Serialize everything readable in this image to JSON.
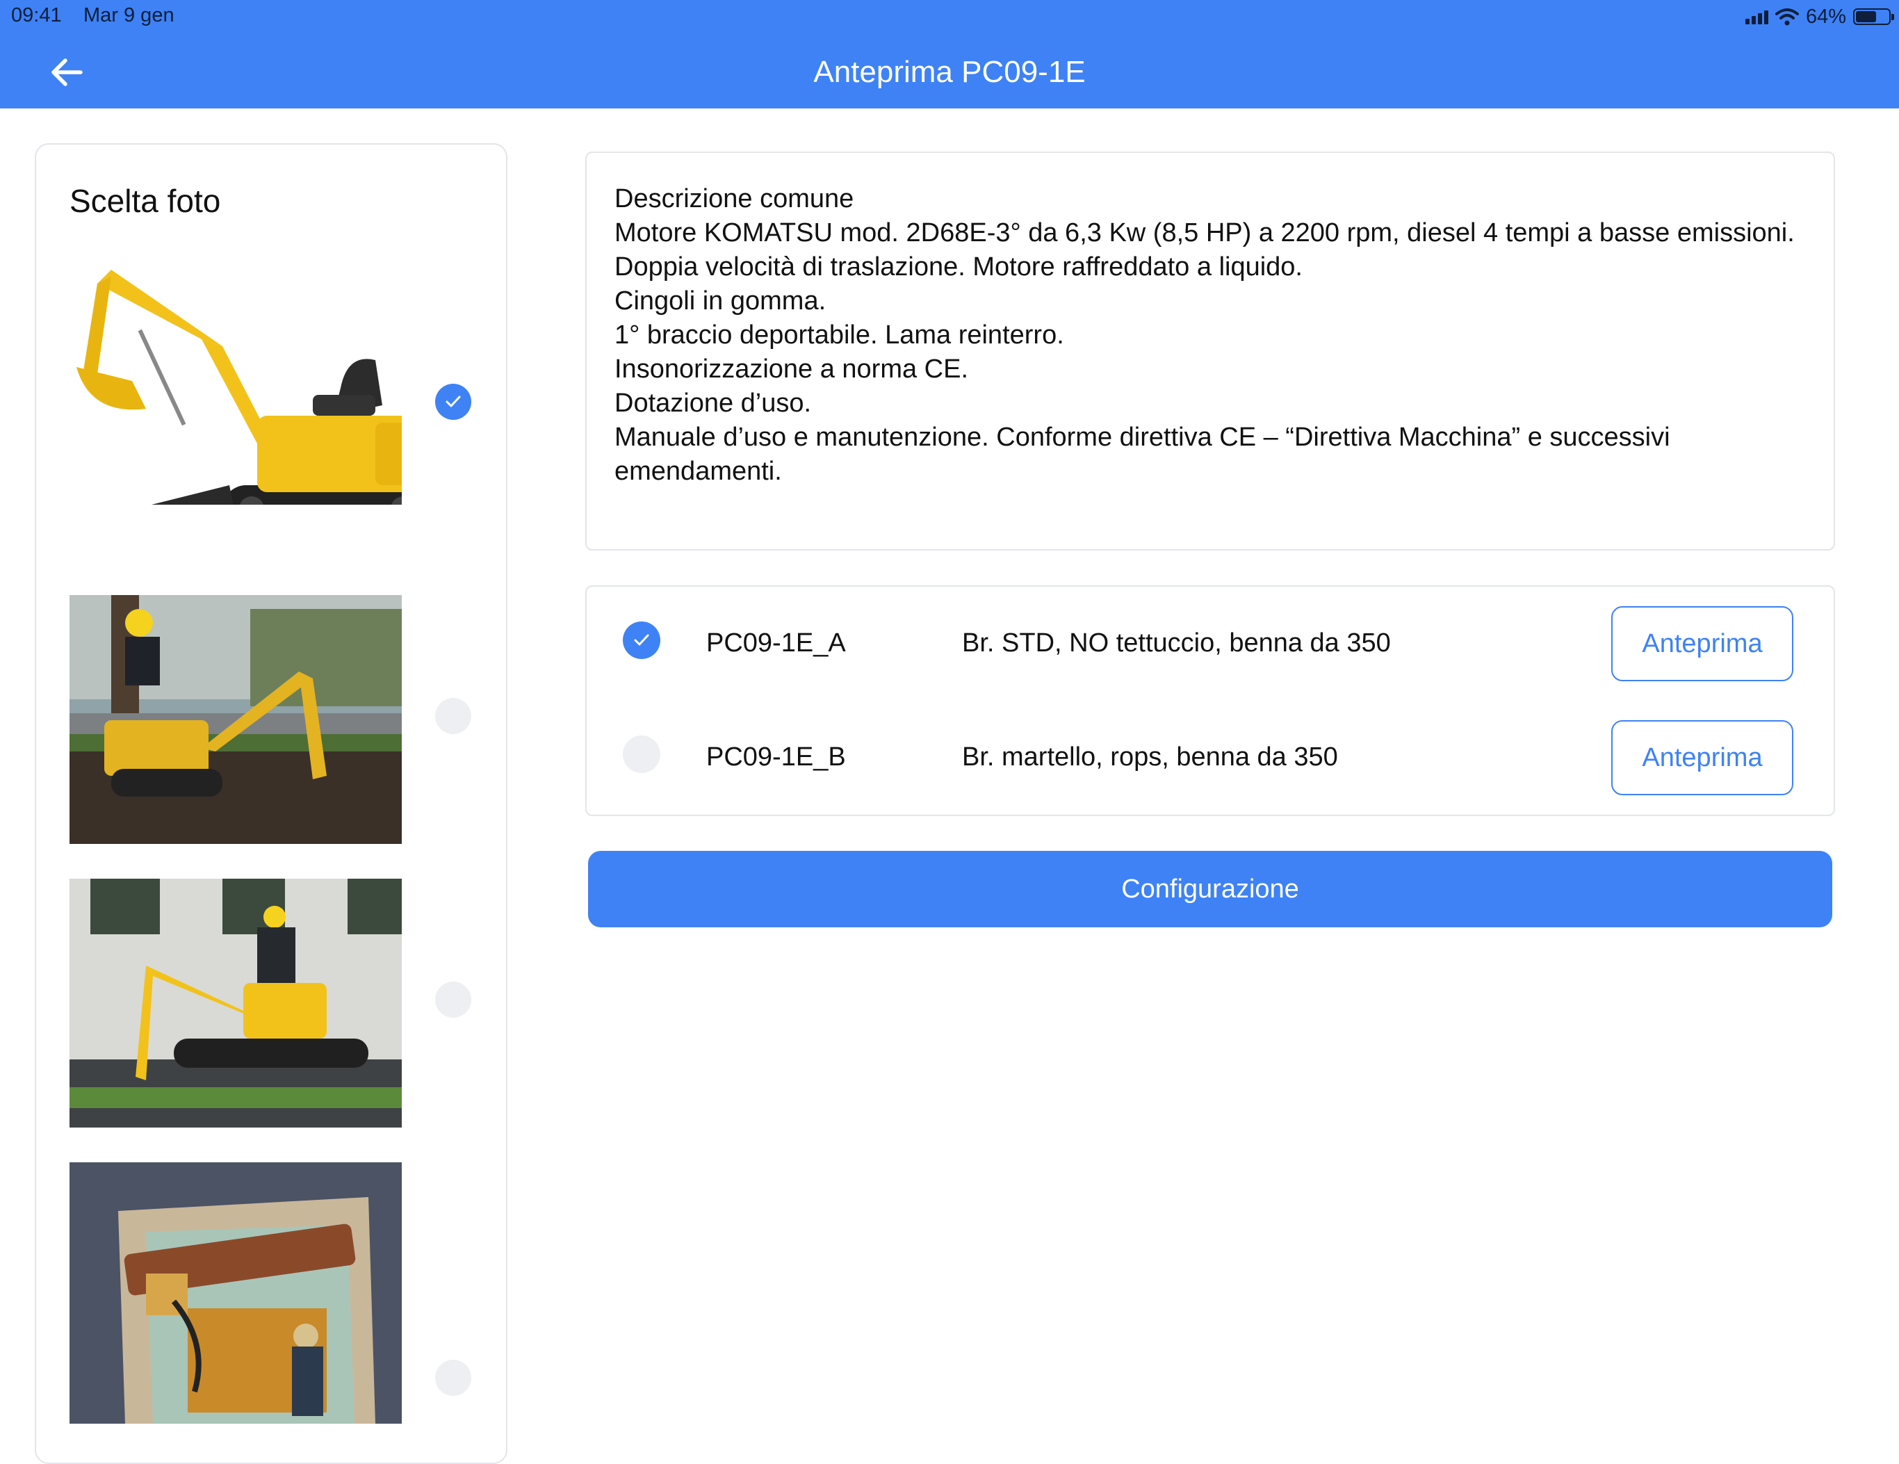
{
  "status_bar": {
    "time": "09:41",
    "date": "Mar 9 gen",
    "battery_percent": "64%",
    "battery_level": 0.64,
    "icons": [
      "signal-icon",
      "wifi-icon",
      "battery-icon"
    ]
  },
  "nav": {
    "back_icon": "arrow-left-icon",
    "title": "Anteprima PC09-1E"
  },
  "photo_picker": {
    "title": "Scelta foto",
    "photos": [
      {
        "name": "excavator-studio-photo",
        "selected": true
      },
      {
        "name": "excavator-operator-digging-photo",
        "selected": false
      },
      {
        "name": "excavator-operator-building-photo",
        "selected": false
      },
      {
        "name": "excavator-demolition-hammer-photo",
        "selected": false
      }
    ]
  },
  "description": {
    "lines": [
      "Descrizione comune",
      "Motore KOMATSU mod. 2D68E-3° da 6,3 Kw (8,5 HP) a 2200 rpm, diesel 4 tempi a basse emissioni.",
      "Doppia velocità di traslazione. Motore raffreddato a liquido.",
      "Cingoli in gomma.",
      "1° braccio deportabile. Lama reinterro.",
      "Insonorizzazione a norma CE.",
      "Dotazione d’uso.",
      "Manuale d’uso e manutenzione. Conforme direttiva CE – “Direttiva Macchina” e successivi emendamenti."
    ]
  },
  "variants": [
    {
      "code": "PC09-1E_A",
      "description": "Br. STD, NO tettuccio, benna da 350",
      "selected": true,
      "button_label": "Anteprima"
    },
    {
      "code": "PC09-1E_B",
      "description": "Br. martello, rops, benna da 350",
      "selected": false,
      "button_label": "Anteprima"
    }
  ],
  "config_button": "Configurazione",
  "colors": {
    "accent": "#3e82f5",
    "excavator_yellow": "#f2c21b",
    "radio_off": "#eeeff2"
  }
}
